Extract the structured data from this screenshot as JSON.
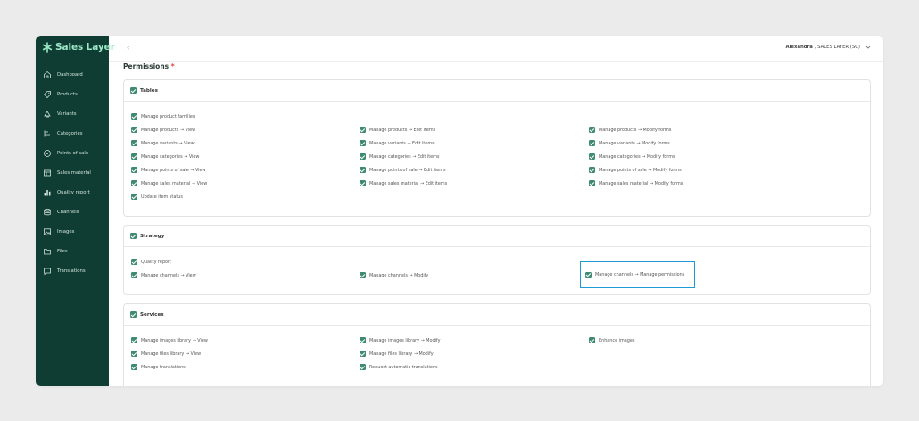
{
  "brand": {
    "name": "Sales Layer",
    "color": "#9be7c6"
  },
  "sidebar": {
    "items": [
      {
        "label": "Dashboard",
        "icon": "home-icon"
      },
      {
        "label": "Products",
        "icon": "tag-icon"
      },
      {
        "label": "Variants",
        "icon": "variants-icon"
      },
      {
        "label": "Categories",
        "icon": "categories-icon"
      },
      {
        "label": "Points of sale",
        "icon": "location-icon"
      },
      {
        "label": "Sales material",
        "icon": "sales-material-icon"
      },
      {
        "label": "Quality report",
        "icon": "bar-chart-icon"
      },
      {
        "label": "Channels",
        "icon": "channels-icon"
      },
      {
        "label": "Images",
        "icon": "image-icon"
      },
      {
        "label": "Files",
        "icon": "folder-icon"
      },
      {
        "label": "Translations",
        "icon": "chat-icon"
      }
    ]
  },
  "topbar": {
    "back_glyph": "‹",
    "user_name": "Alexandra",
    "user_org": ", SALES LAYER (SC)"
  },
  "permissions": {
    "title": "Permissions",
    "required_mark": "*",
    "sections": [
      {
        "title": "Tables",
        "rows": [
          [
            "Manage product families",
            null,
            null
          ],
          [
            "Manage products → View",
            "Manage products → Edit items",
            "Manage products → Modify forms"
          ],
          [
            "Manage variants → View",
            "Manage variants → Edit items",
            "Manage variants → Modify forms"
          ],
          [
            "Manage categories → View",
            "Manage categories → Edit items",
            "Manage categories → Modify forms"
          ],
          [
            "Manage points of sale → View",
            "Manage points of sale → Edit items",
            "Manage points of sale → Modify forms"
          ],
          [
            "Manage sales material → View",
            "Manage sales material → Edit items",
            "Manage sales material → Modify forms"
          ],
          [
            "Update item status",
            null,
            null
          ]
        ]
      },
      {
        "title": "Strategy",
        "rows": [
          [
            "Quality report",
            null,
            null
          ],
          [
            "Manage channels → View",
            "Manage channels → Modify",
            "Manage channels → Manage permissions"
          ]
        ],
        "highlighted": "Manage channels → Manage permissions"
      },
      {
        "title": "Services",
        "rows": [
          [
            "Manage images library → View",
            "Manage images library → Modify",
            "Enhance images"
          ],
          [
            "Manage files library → View",
            "Manage files library → Modify",
            null
          ],
          [
            "Manage translations",
            "Request automatic translations",
            null
          ]
        ]
      }
    ]
  },
  "colors": {
    "sidebar": "#0f3d33",
    "checkbox": "#3e8a73",
    "highlight": "#1e9ad6",
    "required": "#e0483f"
  }
}
